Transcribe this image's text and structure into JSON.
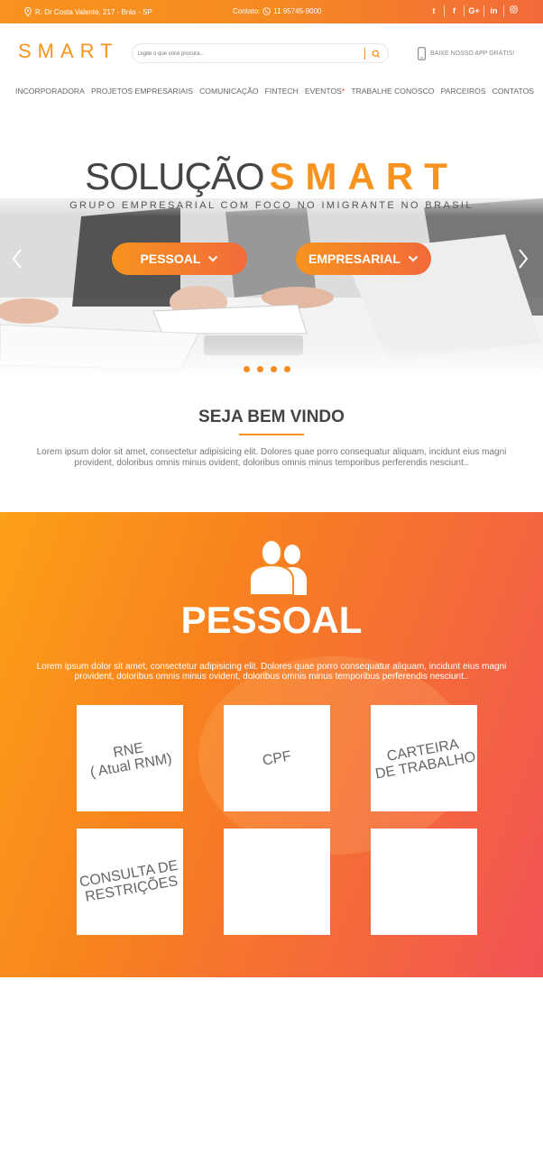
{
  "topbar": {
    "address": "R. Dr Costa Valente, 217 - Brás - SP",
    "contact_label": "Contato:",
    "phone": "11 95745-9000",
    "social": [
      "twitter-icon",
      "facebook-icon",
      "google-plus-icon",
      "linkedin-icon",
      "instagram-icon"
    ]
  },
  "header": {
    "logo": "SMART",
    "search_placeholder": "Digite o que você procura...",
    "app_text": "BAIXE NOSSO APP GRÁTIS!"
  },
  "nav": {
    "items": [
      "INCORPORADORA",
      "PROJETOS EMPRESARIAIS",
      "COMUNICAÇÃO",
      "FINTECH",
      "EVENTOS",
      "TRABALHE CONOSCO",
      "PARCEIROS",
      "CONTATOS"
    ],
    "events_marker": "*"
  },
  "hero": {
    "title_part1": "SOLUÇÃO",
    "title_part2": "SMART",
    "subtitle": "GRUPO EMPRESARIAL COM FOCO NO IMIGRANTE NO BRASIL",
    "btn_personal": "PESSOAL",
    "btn_business": "EMPRESARIAL",
    "slide_count": 4
  },
  "welcome": {
    "title": "SEJA BEM VINDO",
    "text": "Lorem ipsum dolor sit amet, consectetur adipisicing elit. Dolores quae porro consequatur aliquam, incidunt eius magni provident, doloribus omnis minus ovident, doloribus omnis minus temporibus perferendis nesciunt.."
  },
  "personal": {
    "title": "PESSOAL",
    "text": "Lorem ipsum dolor sit amet, consectetur adipisicing elit. Dolores quae porro consequatur aliquam, incidunt eius magni provident, doloribus omnis minus ovident, doloribus omnis minus temporibus perferendis nesciunt..",
    "cards": [
      "RNE\n( Atual RNM)",
      "CPF",
      "CARTEIRA\nDE TRABALHO",
      "CONSULTA DE\nRESTRIÇÕES",
      "",
      ""
    ]
  },
  "colors": {
    "accent": "#f7931e",
    "accent2": "#f26a3a"
  }
}
